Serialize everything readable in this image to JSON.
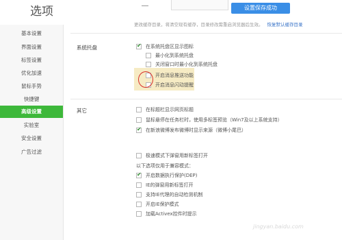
{
  "header": {
    "title": "选项",
    "save_status": "设置保存成功"
  },
  "storage_hint": {
    "text": "更改缓存目录，将清空现有缓存，目录修改需重启浏览器后生效。",
    "restore_link": "恢复默认缓存目录"
  },
  "sidebar": {
    "items": [
      {
        "label": "基本设置"
      },
      {
        "label": "界面设置"
      },
      {
        "label": "标签设置"
      },
      {
        "label": "优化加速"
      },
      {
        "label": "鼠标手势"
      },
      {
        "label": "快捷键"
      },
      {
        "label": "高级设置",
        "active": true
      },
      {
        "label": "实验室"
      },
      {
        "label": "安全设置"
      },
      {
        "label": "广告过滤"
      }
    ]
  },
  "tray": {
    "label": "系统托盘",
    "options": [
      {
        "label": "在系统托盘区显示图标",
        "checked": true
      },
      {
        "label": "最小化到系统托盘",
        "checked": false
      },
      {
        "label": "关闭窗口时最小化到系统托盘",
        "checked": false
      },
      {
        "label": "开启消息推送功能",
        "checked": false
      },
      {
        "label": "开启消息闪动提醒",
        "checked": false
      }
    ]
  },
  "other": {
    "label": "其它",
    "options": [
      {
        "label": "在标题栏显示网页标题",
        "checked": false
      },
      {
        "label": "鼠标悬停在任务栏时，使用多标签预览（Win7及以上系统支持）",
        "checked": false
      },
      {
        "label": "在新浪微博发布微博时显示来源（微博小尾巴）",
        "checked": true
      }
    ]
  },
  "extra": {
    "option_top": {
      "label": "极速模式下弹窗用新标签打开",
      "checked": false
    },
    "compat_note": "以下选项仅用于兼容模式：",
    "options": [
      {
        "label": "开启数据执行保护(DEP)",
        "checked": true
      },
      {
        "label": "IE的弹窗用新标签打开",
        "checked": false
      },
      {
        "label": "支持IE代理的自动检测机制",
        "checked": false
      },
      {
        "label": "开启IE保护模式",
        "checked": false
      },
      {
        "label": "加载Activex控件时提示",
        "checked": false
      }
    ]
  },
  "watermark": "jingyan.baidu.com",
  "colors": {
    "accent_green": "#3db83a",
    "save_blue": "#3a8ee6",
    "annotation_red": "#d9302a"
  }
}
